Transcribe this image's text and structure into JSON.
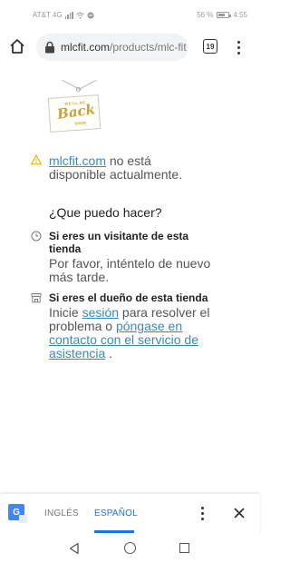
{
  "status_bar": {
    "carrier": "AT&T 4G",
    "battery_percent": "56 %",
    "time": "4:55"
  },
  "browser": {
    "url_domain": "mlcfit.com",
    "url_path": "/products/mlc-fit",
    "tab_count": "19",
    "home_icon": "home-icon",
    "lock_icon": "lock-icon",
    "menu_icon": "more-vert-icon"
  },
  "sign": {
    "top_text": "WE'LL BE",
    "main_text": "Back",
    "bottom_text": "SOON!"
  },
  "notice": {
    "site_link": "mlcfit.com",
    "line1_rest": " no está",
    "line2": "disponible actualmente.",
    "icon": "warning-icon"
  },
  "question": "¿Que puedo hacer?",
  "visitor": {
    "title_line1": "Si eres un visitante de esta",
    "title_line2": "tienda",
    "body_line1": "Por favor, inténtelo de nuevo",
    "body_line2": "más tarde.",
    "icon": "clock-icon"
  },
  "owner": {
    "title": "Si eres el dueño de esta tienda",
    "body_prefix": "Inicie ",
    "login_link": "sesión",
    "body_mid": " para resolver el",
    "body_line2_prefix": "problema o ",
    "contact_link_part1": "póngase en",
    "contact_link_part2": "contacto con el servicio de",
    "contact_link_part3": "asistencia",
    "body_suffix": " .",
    "icon": "store-icon"
  },
  "translate_bar": {
    "lang_source": "INGLÉS",
    "lang_target": "ESPAÑOL",
    "g_icon_label": "G",
    "active_color": "#1a73e8"
  },
  "colors": {
    "link": "#3a88b8",
    "sign_gold": "#c9a13c",
    "warning": "#e0a800"
  }
}
